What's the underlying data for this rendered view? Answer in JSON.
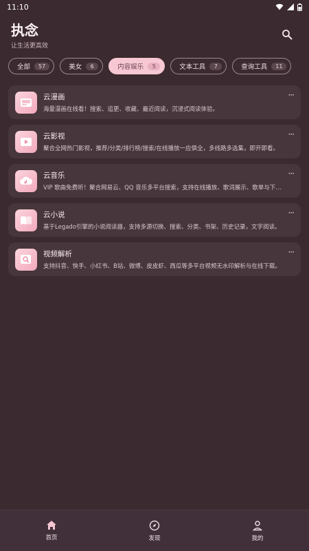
{
  "status": {
    "time": "11:10"
  },
  "header": {
    "title": "执念",
    "subtitle": "让生活更高效"
  },
  "tabs": [
    {
      "label": "全部",
      "count": "57",
      "active": false
    },
    {
      "label": "美女",
      "count": "6",
      "active": false
    },
    {
      "label": "内容娱乐",
      "count": "5",
      "active": true
    },
    {
      "label": "文本工具",
      "count": "7",
      "active": false
    },
    {
      "label": "查询工具",
      "count": "11",
      "active": false
    }
  ],
  "apps": [
    {
      "name": "云漫画",
      "icon": "comic-icon",
      "desc": "海量漫画在线看！搜索、追更、收藏、最近阅读，沉浸式阅读体验。"
    },
    {
      "name": "云影视",
      "icon": "video-icon",
      "desc": "聚合全网热门影视，推荐/分类/排行榜/搜索/在线播放一应俱全，多线路多选集，即开即看。"
    },
    {
      "name": "云音乐",
      "icon": "cloud-music-icon",
      "desc": "VIP 歌曲免费听！聚合网易云、QQ 音乐多平台搜索，支持在线播放、歌词展示、歌单与下载。"
    },
    {
      "name": "云小说",
      "icon": "book-icon",
      "desc": "基于Legado引擎的小说阅读器，支持多源切换、搜索、分类、书架、历史记录，文字阅读。"
    },
    {
      "name": "视频解析",
      "icon": "video-parse-icon",
      "desc": "支持抖音、快手、小红书、B站、微博、皮皮虾、西瓜等多平台视频无水印解析与在线下载。"
    }
  ],
  "nav": [
    {
      "label": "首页",
      "icon": "home-icon"
    },
    {
      "label": "发现",
      "icon": "compass-icon"
    },
    {
      "label": "我的",
      "icon": "profile-icon"
    }
  ],
  "colors": {
    "background": "#3b2a2f",
    "accent": "#f7c8d4",
    "card": "#47363b"
  }
}
